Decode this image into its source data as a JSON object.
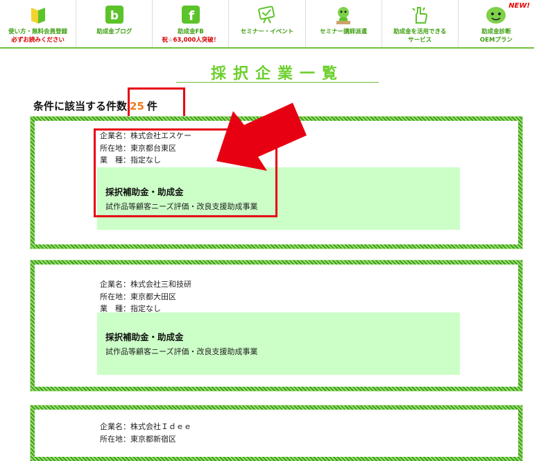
{
  "nav": {
    "items": [
      {
        "label1": "使い方・無料会員登録",
        "label2": "必ずお読みください",
        "label2_red": true,
        "icon": "beginner-mark-icon"
      },
      {
        "label1": "助成金ブログ",
        "label2": "",
        "label2_red": false,
        "icon": "blog-icon"
      },
      {
        "label1": "助成金FB",
        "label2": "祝☆63,000人突破！",
        "label2_red": true,
        "icon": "facebook-icon"
      },
      {
        "label1": "セミナー・イベント",
        "label2": "",
        "label2_red": false,
        "icon": "seminar-board-icon"
      },
      {
        "label1": "セミナー講師派遣",
        "label2": "",
        "label2_red": false,
        "icon": "lecturer-mascot-icon"
      },
      {
        "label1": "助成金を活用できる",
        "label2": "サービス",
        "label2_red": false,
        "icon": "thumbs-up-icon"
      },
      {
        "label1": "助成金診断",
        "label2": "OEMプラン",
        "label2_red": false,
        "icon": "mascot-diagnosis-icon",
        "badge": "NEW!"
      }
    ]
  },
  "page_title": "採択企業一覧",
  "count": {
    "prefix": "条件に該当する件数",
    "number": "25",
    "suffix": "件"
  },
  "labels": {
    "company": "企業名：",
    "location": "所在地：",
    "industry": "業　種："
  },
  "subsidy_heading": "採択補助金・助成金",
  "companies": [
    {
      "name": "株式会社エスケー",
      "location": "東京都台東区",
      "industry": "指定なし",
      "subsidy": "試作品等顧客ニーズ評価・改良支援助成事業"
    },
    {
      "name": "株式会社三和技研",
      "location": "東京都大田区",
      "industry": "指定なし",
      "subsidy": "試作品等顧客ニーズ評価・改良支援助成事業"
    },
    {
      "name": "株式会社Ｉｄｅｅ",
      "location": "東京都新宿区",
      "industry": "",
      "subsidy": ""
    }
  ],
  "colors": {
    "accent_green": "#6ccf2c",
    "highlight_red": "#e60012",
    "count_orange": "#f07b1b",
    "subsidy_bg": "#ccffc7"
  }
}
